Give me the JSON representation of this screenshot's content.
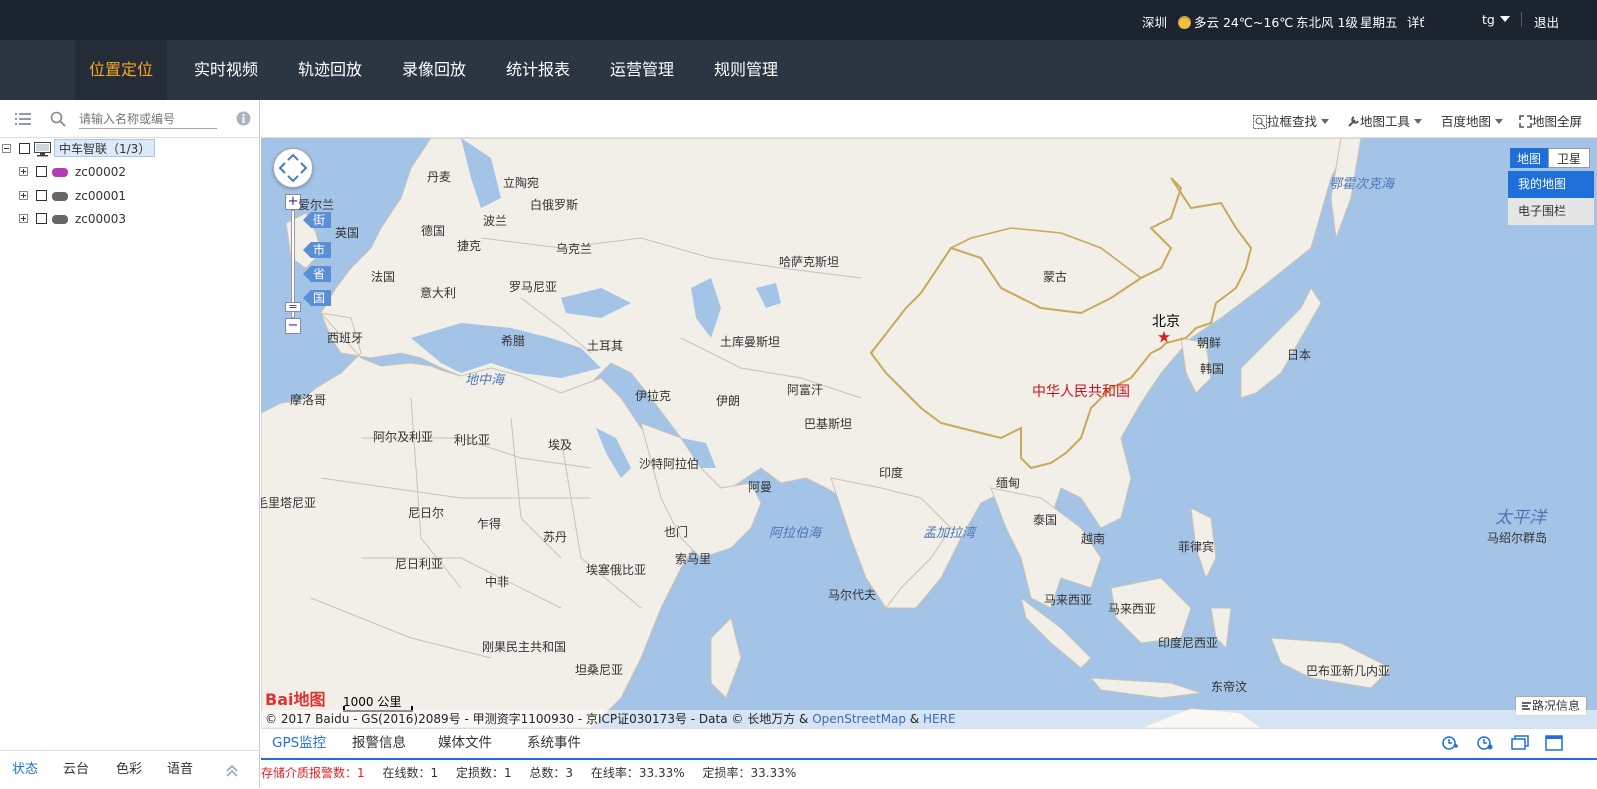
{
  "topbar": {
    "city": "深圳",
    "weather": "多云 24℃~16℃",
    "wind": "东北风 1级",
    "weekday": "星期五",
    "detail": "详ť",
    "user": "tg",
    "logout": "退出"
  },
  "nav": {
    "tabs": [
      {
        "label": "位置定位",
        "active": true
      },
      {
        "label": "实时视频"
      },
      {
        "label": "轨迹回放"
      },
      {
        "label": "录像回放"
      },
      {
        "label": "统计报表"
      },
      {
        "label": "运营管理"
      },
      {
        "label": "规则管理"
      }
    ]
  },
  "left": {
    "search_placeholder": "请输入名称或编号",
    "root": "中车智联（1/3）",
    "vehicles": [
      {
        "id": "zc00002",
        "color": "#b33bb3"
      },
      {
        "id": "zc00001",
        "color": "#666666"
      },
      {
        "id": "zc00003",
        "color": "#666666"
      }
    ],
    "bottom_tabs": [
      "状态",
      "云台",
      "色彩",
      "语音"
    ]
  },
  "map_toolbar": {
    "box_search": "拉框查找",
    "map_tools": "地图工具",
    "baidu_map": "百度地图",
    "fullscreen": "地图全屏"
  },
  "map": {
    "zoom_levels": [
      "街",
      "市",
      "省",
      "国"
    ],
    "type_buttons": [
      "地图",
      "卫星"
    ],
    "type_menu": [
      "我的地图",
      "电子围栏"
    ],
    "traffic": "路况信息",
    "scale": "1000 公里",
    "logo": "Bai地图",
    "copyright_prefix": "© 2017 Baidu - GS(2016)2089号 - 甲测资字1100930 - 京ICP证030173号 - Data © 长地万方 & ",
    "copyright_osm": "OpenStreetMap",
    "copyright_amp": " & ",
    "copyright_here": "HERE",
    "country_labels": [
      "丹麦",
      "立陶宛",
      "爱尔兰",
      "白俄罗斯",
      "英国",
      "德国",
      "波兰",
      "捷克",
      "乌克兰",
      "法国",
      "意大利",
      "罗马尼亚",
      "西班牙",
      "希腊",
      "土耳其",
      "土库曼斯坦",
      "哈萨克斯坦",
      "蒙古",
      "朝鲜",
      "韩国",
      "日本",
      "摩洛哥",
      "阿尔及利亚",
      "利比亚",
      "埃及",
      "伊拉克",
      "伊朗",
      "阿富汗",
      "巴基斯坦",
      "沙特阿拉伯",
      "印度",
      "缅甸",
      "泰国",
      "越南",
      "菲律宾",
      "毛里塔尼亚",
      "尼日尔",
      "乍得",
      "苏丹",
      "也门",
      "阿曼",
      "尼日利亚",
      "中非",
      "埃塞俄比亚",
      "索马里",
      "马尔代夫",
      "马来西亚",
      "马来西亚",
      "印度尼西亚",
      "刚果民主共和国",
      "坦桑尼亚",
      "东帝汶",
      "巴布亚新几内亚",
      "马绍尔群岛"
    ],
    "seas": [
      "地中海",
      "阿拉伯海",
      "孟加拉湾",
      "鄂霍次克海",
      "太平洋"
    ],
    "china": "中华人民共和国",
    "capital": "北京"
  },
  "bottom": {
    "tabs": [
      {
        "label": "GPS监控",
        "active": true
      },
      {
        "label": "报警信息"
      },
      {
        "label": "媒体文件"
      },
      {
        "label": "系统事件"
      }
    ],
    "stats": {
      "storage_alarm": "存储介质报警数：1",
      "online": "在线数：1",
      "located": "定损数：1",
      "total": "总数：3",
      "online_rate": "在线率：33.33%",
      "loss_rate": "定损率：33.33%"
    }
  }
}
